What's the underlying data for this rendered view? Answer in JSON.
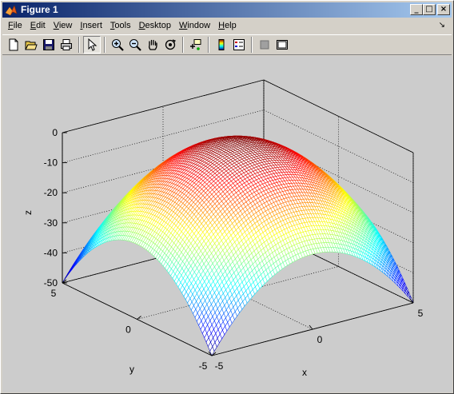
{
  "window": {
    "title": "Figure 1",
    "min": "_",
    "max": "□",
    "close": "×"
  },
  "menu": {
    "items": [
      {
        "label": "File",
        "accel": "F",
        "rest": "ile"
      },
      {
        "label": "Edit",
        "accel": "E",
        "rest": "dit"
      },
      {
        "label": "View",
        "accel": "V",
        "rest": "iew"
      },
      {
        "label": "Insert",
        "accel": "I",
        "rest": "nsert"
      },
      {
        "label": "Tools",
        "accel": "T",
        "rest": "ools"
      },
      {
        "label": "Desktop",
        "accel": "D",
        "rest": "esktop"
      },
      {
        "label": "Window",
        "accel": "W",
        "rest": "indow"
      },
      {
        "label": "Help",
        "accel": "H",
        "rest": "elp"
      }
    ],
    "dock_glyph": "↘"
  },
  "toolbar": {
    "icons": [
      "new-file-icon",
      "open-folder-icon",
      "save-icon",
      "print-icon",
      "pointer-icon",
      "zoom-in-icon",
      "zoom-out-icon",
      "pan-hand-icon",
      "rotate-3d-icon",
      "data-cursor-icon",
      "colorbar-icon",
      "legend-icon",
      "hide-plot-tools-icon",
      "show-plot-tools-icon"
    ],
    "pressed": "pointer-icon"
  },
  "chart_data": {
    "type": "surface",
    "function": "z = -(x^2 + y^2)",
    "x_range": [
      -5,
      5
    ],
    "y_range": [
      -5,
      5
    ],
    "z_range": [
      -50,
      0
    ],
    "grid_resolution": 81,
    "x_ticks": [
      "-5",
      "0",
      "5"
    ],
    "y_ticks": [
      "-5",
      "0",
      "5"
    ],
    "z_ticks": [
      "-50",
      "-40",
      "-30",
      "-20",
      "-10",
      "0"
    ],
    "xlabel": "x",
    "ylabel": "y",
    "zlabel": "z",
    "colormap": "jet",
    "grid": true,
    "box": true
  }
}
